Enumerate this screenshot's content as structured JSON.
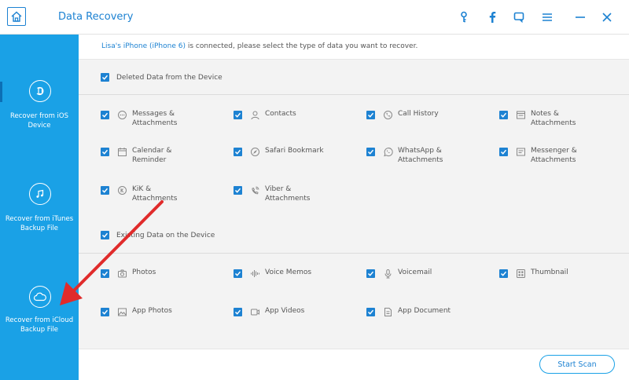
{
  "window": {
    "title": "Data Recovery",
    "accent": "#1d82d2",
    "sidebar_color": "#1aa1e6"
  },
  "toolbar": {
    "icons": [
      "key-icon",
      "facebook-icon",
      "feedback-icon",
      "menu-icon",
      "minimize-icon",
      "close-icon"
    ]
  },
  "sidebar": {
    "items": [
      {
        "label": "Recover from iOS Device",
        "icon": "ios-device-icon"
      },
      {
        "label": "Recover from iTunes Backup File",
        "icon": "itunes-music-icon"
      },
      {
        "label": "Recover from iCloud Backup File",
        "icon": "icloud-icon"
      }
    ]
  },
  "status": {
    "device": "Lisa's iPhone (iPhone 6)",
    "message": " is connected, please select the type of data you want to recover."
  },
  "sections": {
    "deleted": {
      "label": "Deleted Data from the Device",
      "checked": true,
      "items": [
        {
          "label": "Messages & Attachments",
          "icon": "message-icon",
          "checked": true
        },
        {
          "label": "Contacts",
          "icon": "contact-icon",
          "checked": true
        },
        {
          "label": "Call History",
          "icon": "phone-icon",
          "checked": true
        },
        {
          "label": "Notes & Attachments",
          "icon": "notes-icon",
          "checked": true
        },
        {
          "label": "Calendar & Reminder",
          "icon": "calendar-icon",
          "checked": true
        },
        {
          "label": "Safari Bookmark",
          "icon": "safari-icon",
          "checked": true
        },
        {
          "label": "WhatsApp & Attachments",
          "icon": "whatsapp-icon",
          "checked": true
        },
        {
          "label": "Messenger & Attachments",
          "icon": "messenger-icon",
          "checked": true
        },
        {
          "label": "KiK & Attachments",
          "icon": "kik-icon",
          "checked": true
        },
        {
          "label": "Viber & Attachments",
          "icon": "viber-icon",
          "checked": true
        }
      ]
    },
    "existing": {
      "label": "Existing Data on the Device",
      "checked": true,
      "items": [
        {
          "label": "Photos",
          "icon": "camera-icon",
          "checked": true
        },
        {
          "label": "Voice Memos",
          "icon": "voice-memo-icon",
          "checked": true
        },
        {
          "label": "Voicemail",
          "icon": "microphone-icon",
          "checked": true
        },
        {
          "label": "Thumbnail",
          "icon": "thumbnail-icon",
          "checked": true
        },
        {
          "label": "App Photos",
          "icon": "image-icon",
          "checked": true
        },
        {
          "label": "App Videos",
          "icon": "video-icon",
          "checked": true
        },
        {
          "label": "App Document",
          "icon": "document-icon",
          "checked": true
        }
      ]
    }
  },
  "actions": {
    "start_scan": "Start Scan"
  },
  "annotation": {
    "arrow_color": "#e02b2b"
  }
}
